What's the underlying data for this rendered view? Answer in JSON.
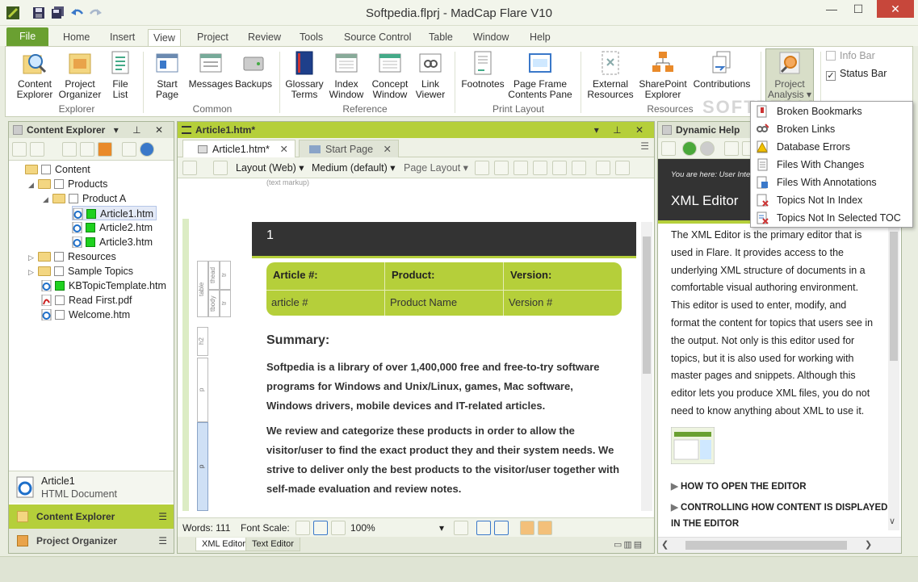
{
  "window": {
    "title": "Softpedia.flprj - MadCap Flare V10",
    "controls": {
      "minimize": "—",
      "maximize": "☐",
      "close": "✕"
    }
  },
  "ribbon": {
    "tabs": [
      "File",
      "Home",
      "Insert",
      "View",
      "Project",
      "Review",
      "Tools",
      "Source Control",
      "Table",
      "Window",
      "Help"
    ],
    "buttons": {
      "content_explorer": [
        "Content",
        "Explorer"
      ],
      "project_organizer": [
        "Project",
        "Organizer"
      ],
      "file_list": [
        "File",
        "List"
      ],
      "start_page": [
        "Start",
        "Page"
      ],
      "messages": "Messages",
      "backups": "Backups",
      "glossary_terms": [
        "Glossary",
        "Terms"
      ],
      "index_window": [
        "Index",
        "Window"
      ],
      "concept_window": [
        "Concept",
        "Window"
      ],
      "link_viewer": [
        "Link",
        "Viewer"
      ],
      "footnotes": "Footnotes",
      "page_frame": [
        "Page Frame",
        "Contents Pane"
      ],
      "external_resources": [
        "External",
        "Resources"
      ],
      "sharepoint_explorer": [
        "SharePoint",
        "Explorer"
      ],
      "contributions": "Contributions",
      "project_analysis": [
        "Project",
        "Analysis ▾"
      ]
    },
    "groups": {
      "explorer": "Explorer",
      "common": "Common",
      "reference": "Reference",
      "print_layout": "Print Layout",
      "resources": "Resources"
    },
    "checks": {
      "info_bar": "Info Bar",
      "status_bar": "Status Bar"
    }
  },
  "project_analysis_menu": [
    "Broken Bookmarks",
    "Broken Links",
    "Database Errors",
    "Files With Changes",
    "Files With Annotations",
    "Topics Not In Index",
    "Topics Not In Selected TOC"
  ],
  "content_explorer": {
    "title": "Content Explorer",
    "tree": [
      "Content",
      "Products",
      "Product A",
      "Article1.htm",
      "Article2.htm",
      "Article3.htm",
      "Resources",
      "Sample Topics",
      "KBTopicTemplate.htm",
      "Read First.pdf",
      "Welcome.htm"
    ],
    "selected": {
      "name": "Article1",
      "type": "HTML Document"
    },
    "accordion": [
      "Content Explorer",
      "Project Organizer"
    ]
  },
  "editor": {
    "title": "Article1.htm*",
    "tabs": [
      "Article1.htm*",
      "Start Page"
    ],
    "toolbar": {
      "layout": "Layout (Web)",
      "medium": "Medium (default)",
      "page_layout": "Page Layout"
    },
    "markup_hint": "(text markup)",
    "structure": [
      "table",
      "thead",
      "tr",
      "tbody",
      "tr",
      "h2",
      "p",
      "p"
    ],
    "doc": {
      "heading_number": "1",
      "table_headers": [
        "Article #:",
        "Product:",
        "Version:"
      ],
      "table_values": [
        "article #",
        "Product Name",
        "Version #"
      ],
      "summary_title": "Summary:",
      "para1": [
        "Softpedia is a library of over 1,400,000 free and free-to-try software",
        "programs for Windows and Unix/Linux, games, Mac software,",
        "Windows drivers, mobile devices and IT-related articles."
      ],
      "para2": [
        "We review and categorize these products in order to allow the",
        "visitor/user to find the exact product they and their system needs. We",
        "strive to deliver only the best products to the visitor/user together with",
        "self-made evaluation and review notes."
      ]
    },
    "status": {
      "words": "Words: 111",
      "font_scale": "Font Scale:",
      "zoom": "100%"
    },
    "bottom_tabs": [
      "XML Editor",
      "Text Editor"
    ]
  },
  "dynamic_help": {
    "title": "Dynamic Help",
    "breadcrumb": "You are here: User Interf",
    "heading": "XML Editor",
    "body": [
      "The XML Editor is the primary editor that is",
      "used in Flare. It provides access to the",
      "underlying XML structure of documents in a",
      "comfortable visual authoring environment.",
      "This editor is used to enter, modify, and",
      "format the content for topics that users see in",
      "the output. Not only is this editor used for",
      "topics, but it is also used for working with",
      "master pages and snippets. Although this",
      "editor lets you produce XML files, you do not",
      "need to know anything about XML to use it."
    ],
    "links": [
      "HOW TO OPEN THE EDITOR",
      "CONTROLLING HOW CONTENT IS DISPLAYED",
      "IN THE EDITOR"
    ]
  },
  "watermark": "SOFTPEDIA"
}
